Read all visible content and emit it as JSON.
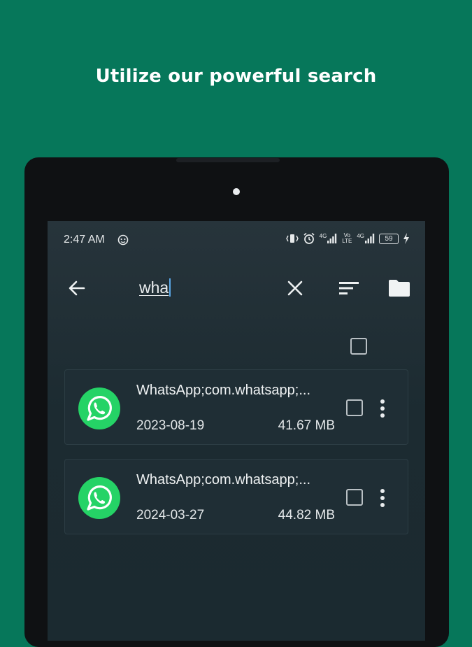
{
  "headline": "Utilize our powerful search",
  "status_bar": {
    "time": "2:47 AM",
    "battery": "59",
    "network_label_1": "4G",
    "network_label_2": "Vo LTE",
    "network_label_3": "4G"
  },
  "search": {
    "query": "wha"
  },
  "colors": {
    "background": "#06775a",
    "screen": "#1c2b31",
    "whatsapp_green": "#25d366"
  },
  "results": [
    {
      "name": "WhatsApp;com.whatsapp;...",
      "date": "2023-08-19",
      "size": "41.67 MB",
      "icon": "whatsapp-icon"
    },
    {
      "name": "WhatsApp;com.whatsapp;...",
      "date": "2024-03-27",
      "size": "44.82 MB",
      "icon": "whatsapp-icon"
    }
  ]
}
